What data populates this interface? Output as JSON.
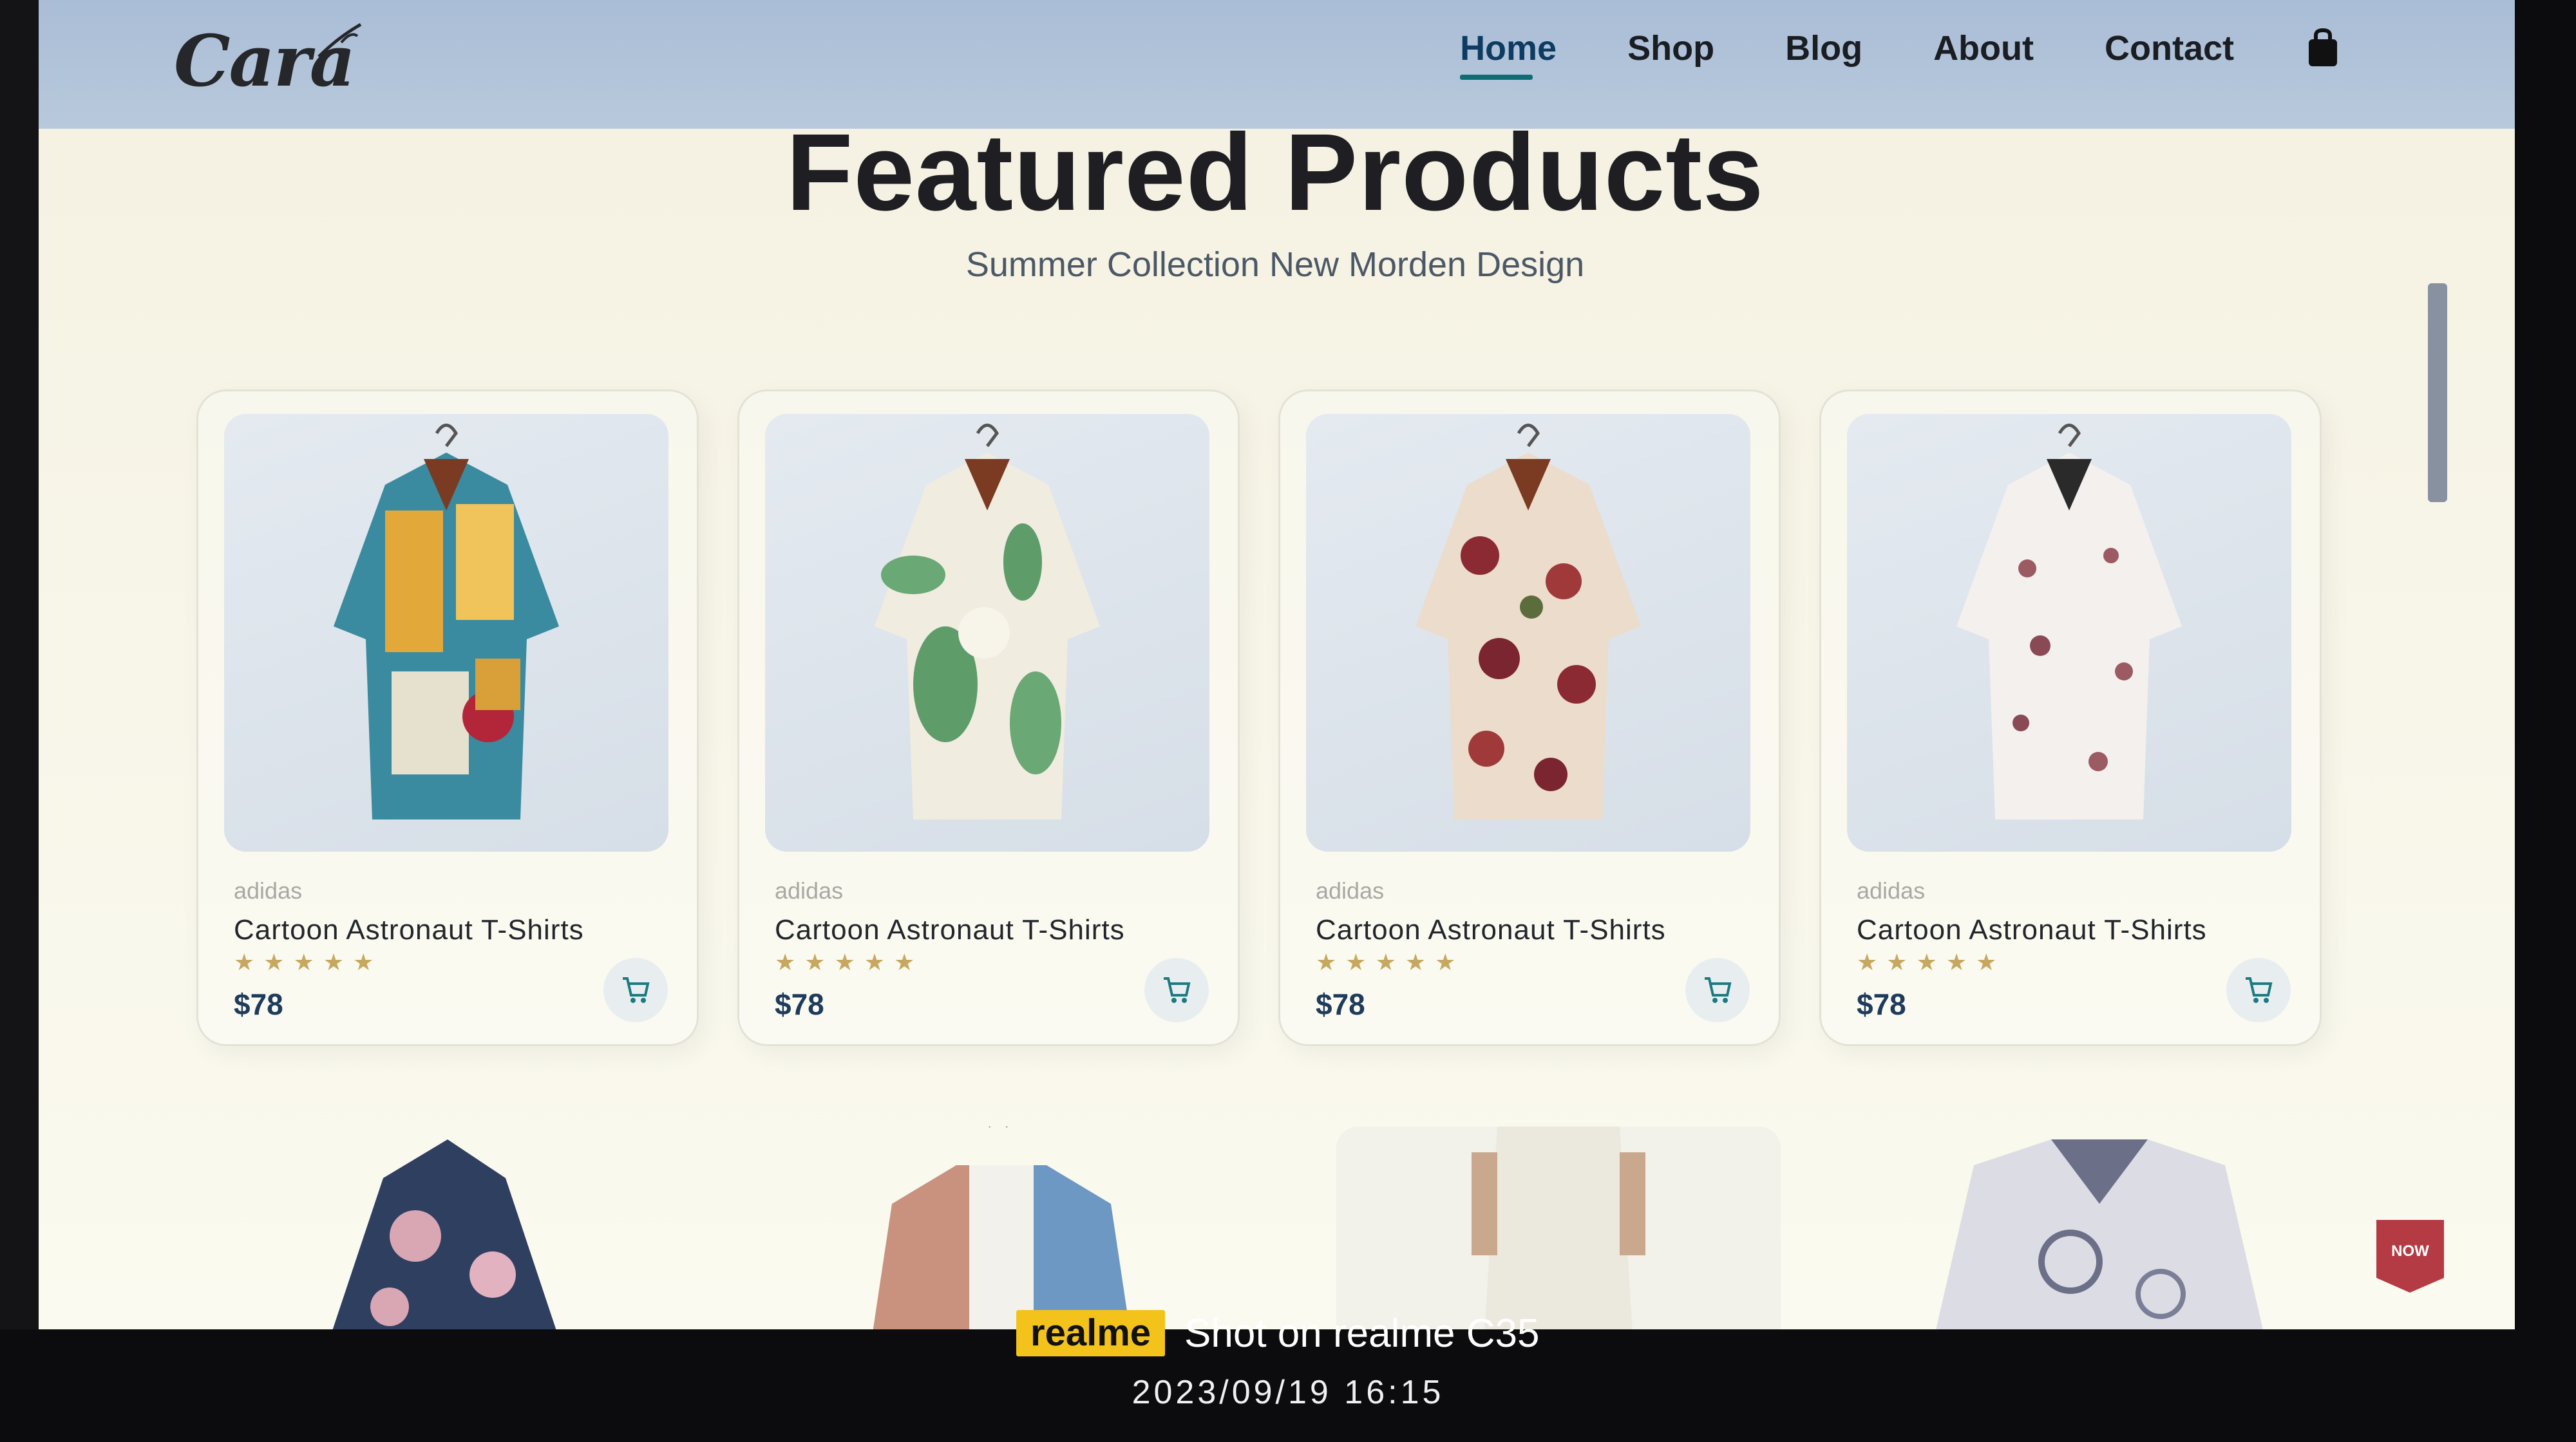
{
  "header": {
    "logo": "Cara",
    "nav": [
      "Home",
      "Shop",
      "Blog",
      "About",
      "Contact"
    ],
    "active": "Home"
  },
  "featured": {
    "title": "Featured Products",
    "subtitle": "Summer Collection New Morden Design"
  },
  "products": [
    {
      "brand": "adidas",
      "name": "Cartoon Astronaut T-Shirts",
      "price": "$78",
      "rating": 5
    },
    {
      "brand": "adidas",
      "name": "Cartoon Astronaut T-Shirts",
      "price": "$78",
      "rating": 5
    },
    {
      "brand": "adidas",
      "name": "Cartoon Astronaut T-Shirts",
      "price": "$78",
      "rating": 5
    },
    {
      "brand": "adidas",
      "name": "Cartoon Astronaut T-Shirts",
      "price": "$78",
      "rating": 5
    }
  ],
  "badge": {
    "label": "NOW"
  },
  "watermark": {
    "brand": "realme",
    "shot": "Shot on realme C35",
    "datetime": "2023/09/19  16:15"
  },
  "colors": {
    "header_bg": "#a9bdd6",
    "accent": "#0f6d76",
    "star": "#c7a860",
    "price": "#1f3b5c"
  }
}
